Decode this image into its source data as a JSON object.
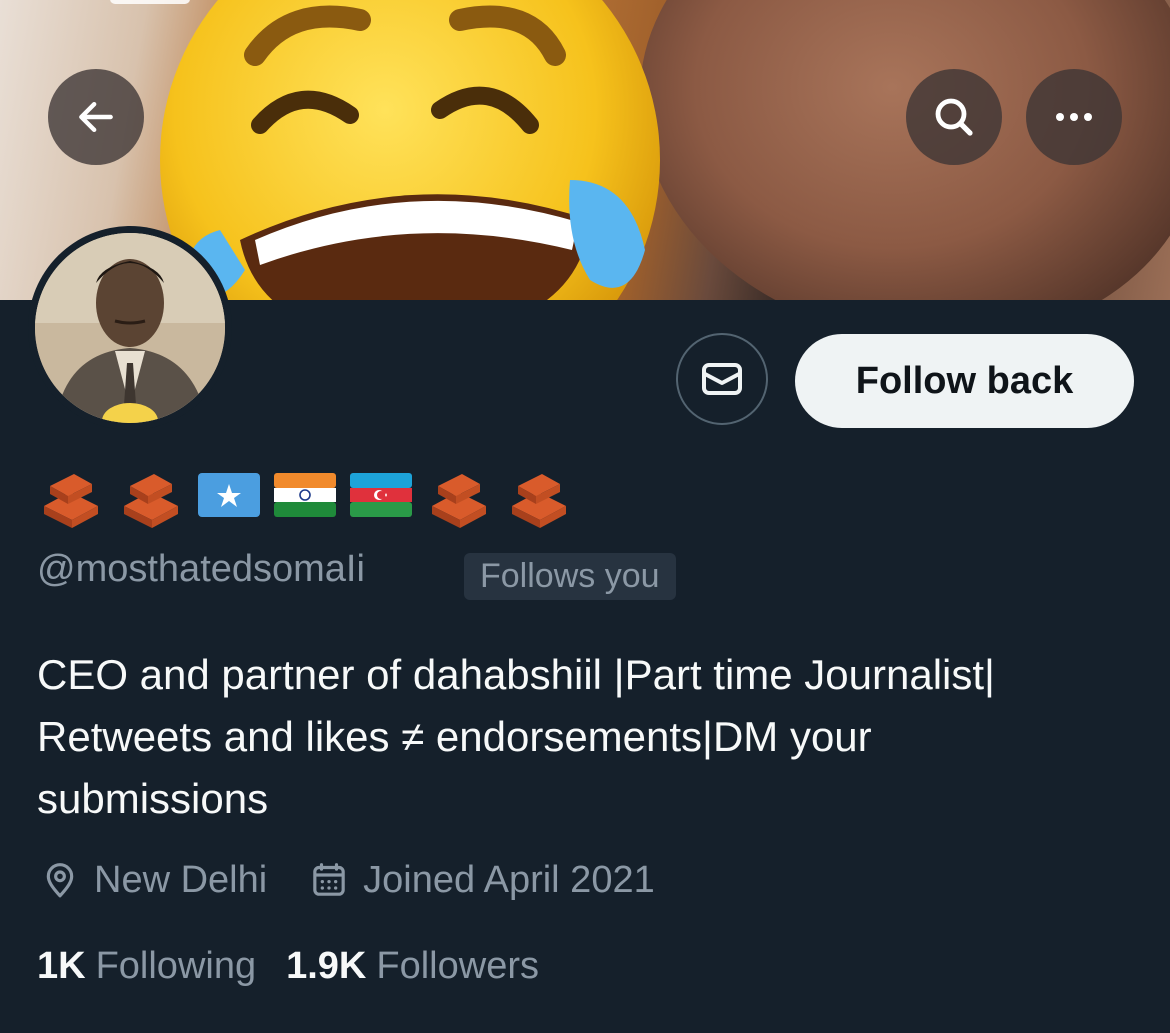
{
  "header": {
    "back_icon": "arrow-left-icon",
    "search_icon": "search-icon",
    "more_icon": "more-horizontal-icon"
  },
  "profile": {
    "name_emojis": [
      "brick",
      "brick",
      "flag-somalia",
      "flag-india",
      "flag-azerbaijan",
      "brick",
      "brick"
    ],
    "handle": "@mosthatedsomaIi",
    "follows_you": "Follows you",
    "bio_lines": [
      "CEO and partner of dahabshiil |Part time Journalist|",
      "Retweets and likes ≠ endorsements|DM your",
      "submissions"
    ],
    "location": "New Delhi",
    "joined": "Joined April 2021",
    "following_count": "1K",
    "following_label": "Following",
    "followers_count": "1.9K",
    "followers_label": "Followers"
  },
  "actions": {
    "message_icon": "envelope-icon",
    "follow_label": "Follow back"
  },
  "colors": {
    "background": "#15202b",
    "text_primary": "#f7f9f9",
    "text_secondary": "#8b98a5",
    "follow_button_bg": "#eff3f4",
    "badge_bg": "#273340"
  }
}
